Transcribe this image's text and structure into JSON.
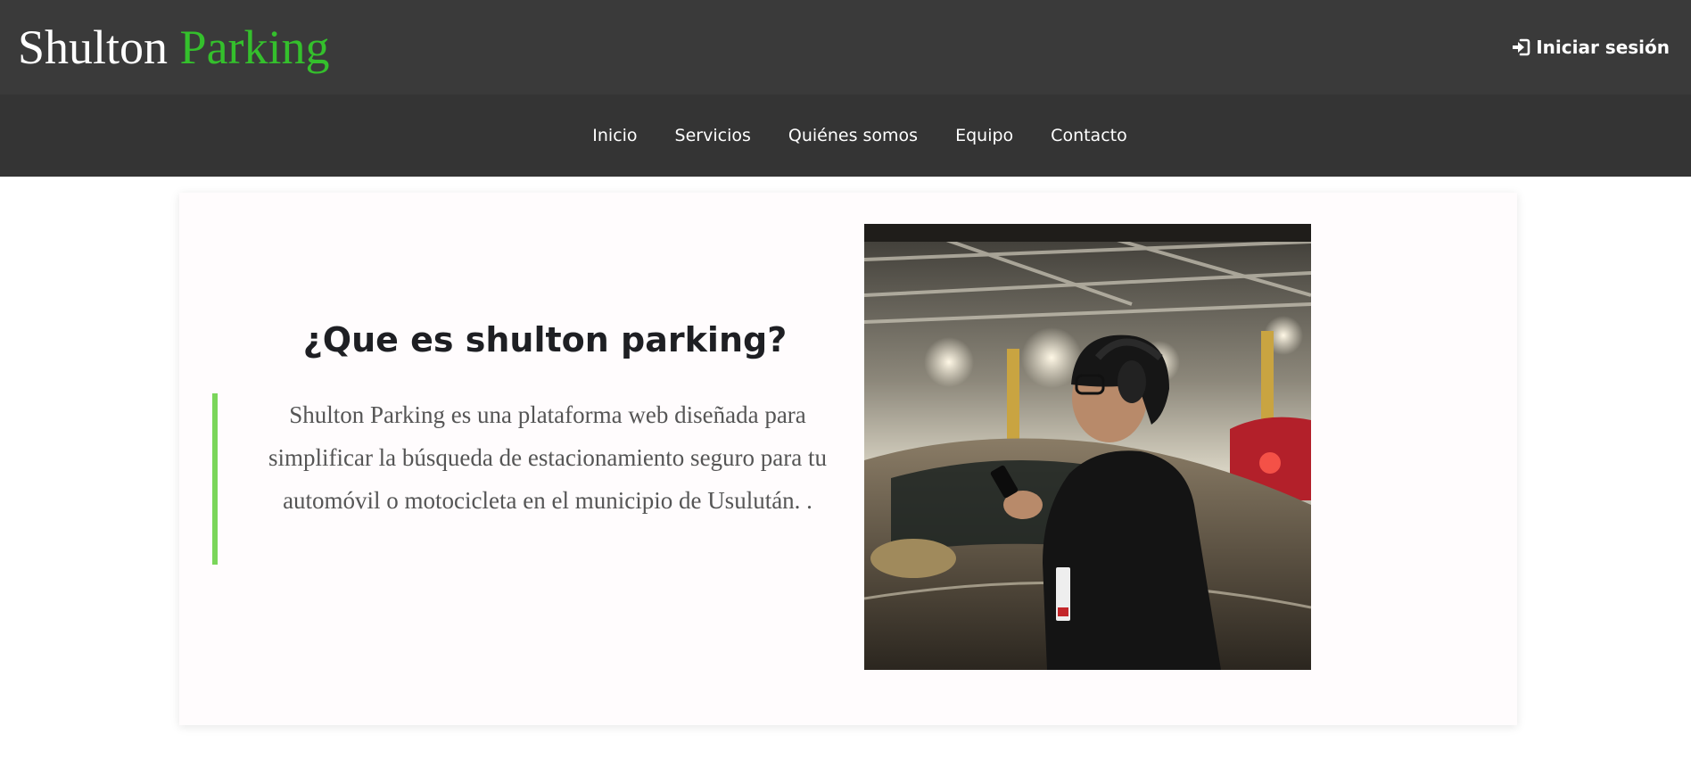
{
  "header": {
    "logo_part1": "Shulton",
    "logo_part2": "Parking",
    "login_label": "Iniciar sesión",
    "login_icon": "sign-in-icon",
    "accent_color": "#34c02c"
  },
  "nav": {
    "items": [
      {
        "label": "Inicio"
      },
      {
        "label": "Servicios"
      },
      {
        "label": "Quiénes somos"
      },
      {
        "label": "Equipo"
      },
      {
        "label": "Contacto"
      }
    ]
  },
  "main": {
    "title": "¿Que es shulton parking?",
    "description": "Shulton Parking es una plataforma web diseñada para simplificar la búsqueda de estacionamiento seguro para tu automóvil o motocicleta en el municipio de Usulután. .",
    "quote_border_color": "#7ad65a"
  }
}
